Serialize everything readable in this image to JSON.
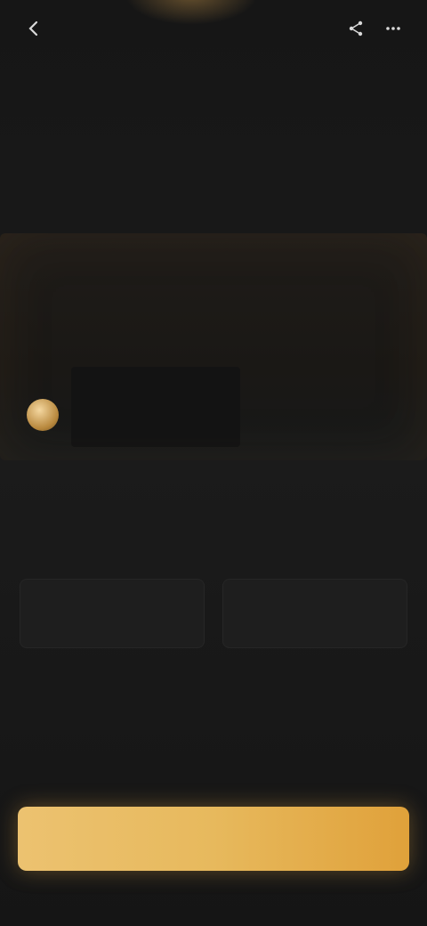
{
  "topbar": {
    "back_icon": "back-arrow-icon",
    "right_icons": [
      "share-icon",
      "more-icon"
    ]
  },
  "headline": {
    "title": "",
    "subtitle": "",
    "description": ""
  },
  "card": {
    "heading": "",
    "body": "",
    "link": ""
  },
  "caption": "",
  "section": {
    "label": "",
    "options": [
      "",
      ""
    ],
    "note": ""
  },
  "cta": {
    "label": ""
  },
  "colors": {
    "accent": "#e7b95d",
    "accent_dark": "#d79a3c",
    "background": "#161616"
  }
}
